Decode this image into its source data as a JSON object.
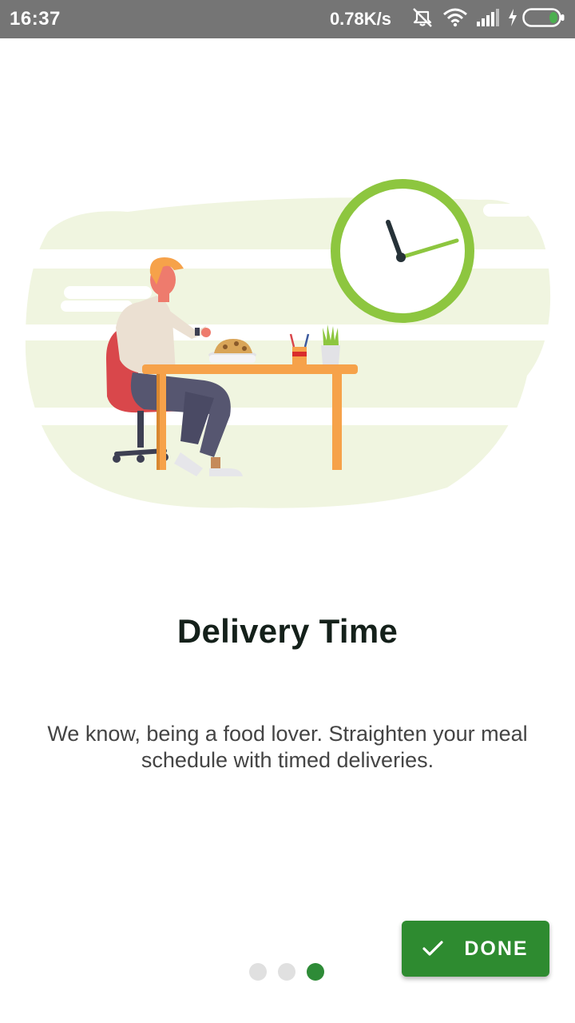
{
  "status_bar": {
    "time": "16:37",
    "net_speed": "0.78K/s",
    "icons": [
      "mute-vibrate-icon",
      "wifi-icon",
      "signal-icon",
      "charging-icon",
      "battery-icon"
    ]
  },
  "onboarding": {
    "illustration": "person-eating-at-table-with-clock",
    "title": "Delivery Time",
    "description": "We know, being a food lover. Straighten your meal schedule with timed deliveries.",
    "page_count": 3,
    "current_page": 3,
    "done_label": "DONE",
    "done_icon": "check-icon"
  },
  "colors": {
    "status_bar": "#757575",
    "accent": "#2e8b30",
    "clock_ring": "#8dc63f",
    "blob": "#f0f5e0",
    "title": "#14201a",
    "text": "#444444"
  }
}
